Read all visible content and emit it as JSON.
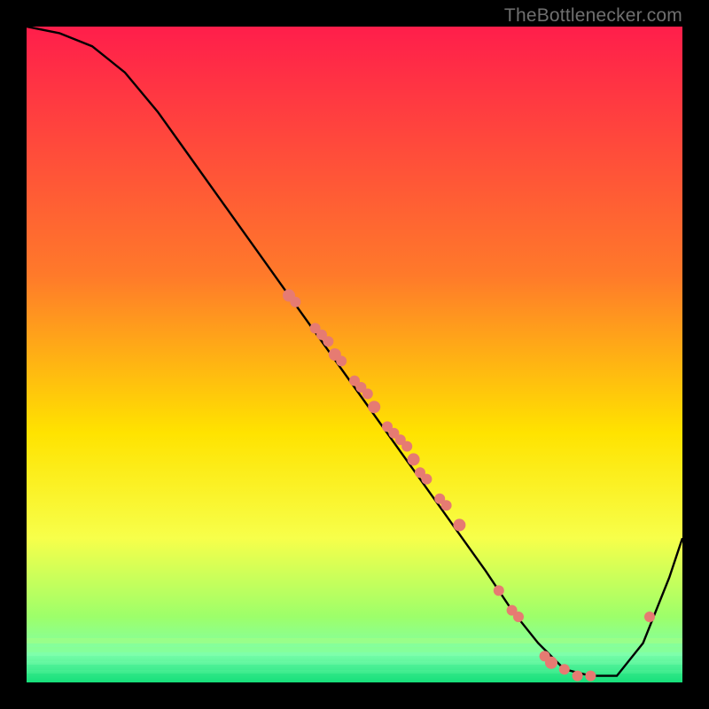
{
  "watermark": "TheBottlenecker.com",
  "colors": {
    "top": "#ff1e4b",
    "mid1": "#ff7a2a",
    "mid2": "#ffe300",
    "mid3": "#f7ff4a",
    "low1": "#9dff6a",
    "bottom": "#18e07b",
    "curve": "#000000",
    "dots": "#e67b72"
  },
  "chart_data": {
    "type": "line",
    "title": "",
    "xlabel": "",
    "ylabel": "",
    "xlim": [
      0,
      100
    ],
    "ylim": [
      0,
      100
    ],
    "series": [
      {
        "name": "bottleneck-curve",
        "x": [
          0,
          5,
          10,
          15,
          20,
          25,
          30,
          35,
          40,
          45,
          50,
          55,
          60,
          65,
          70,
          74,
          78,
          82,
          86,
          90,
          94,
          98,
          100
        ],
        "y": [
          100,
          99,
          97,
          93,
          87,
          80,
          73,
          66,
          59,
          52,
          45,
          38,
          31,
          24,
          17,
          11,
          6,
          2,
          1,
          1,
          6,
          16,
          22
        ]
      },
      {
        "name": "highlight-dots",
        "x": [
          40,
          41,
          44,
          45,
          46,
          47,
          48,
          50,
          51,
          52,
          53,
          55,
          56,
          57,
          58,
          59,
          60,
          61,
          63,
          64,
          66,
          72,
          74,
          75,
          79,
          80,
          82,
          84,
          86,
          95
        ],
        "y": [
          59,
          58,
          54,
          53,
          52,
          50,
          49,
          46,
          45,
          44,
          42,
          39,
          38,
          37,
          36,
          34,
          32,
          31,
          28,
          27,
          24,
          14,
          11,
          10,
          4,
          3,
          2,
          1,
          1,
          10
        ]
      }
    ]
  }
}
